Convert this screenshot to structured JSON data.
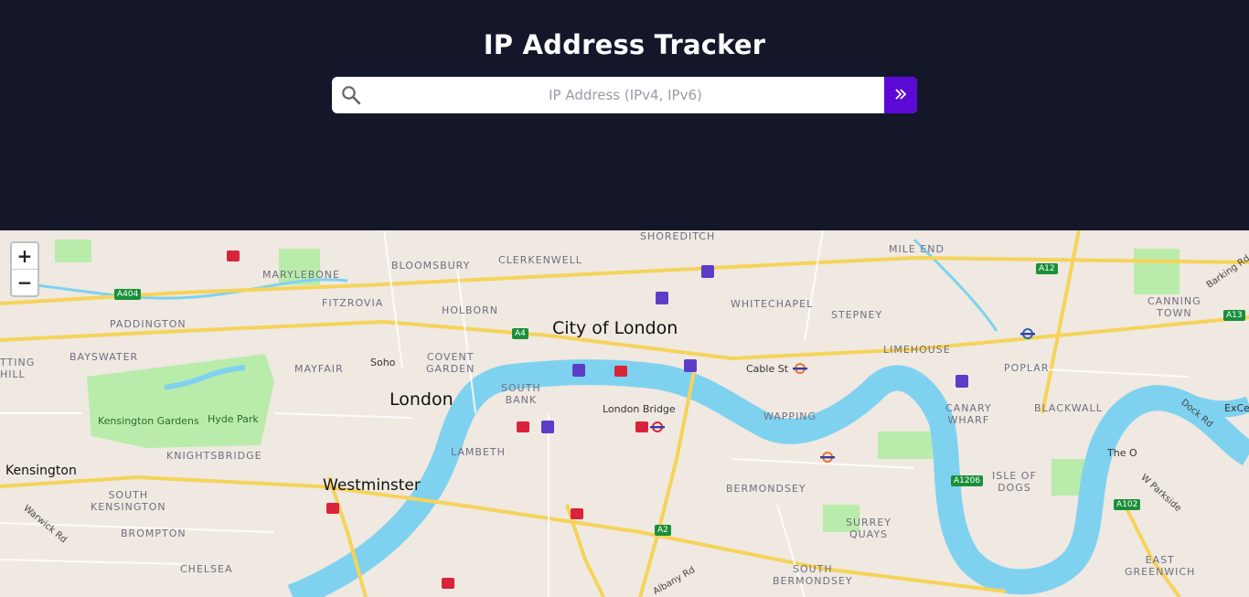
{
  "app": {
    "title": "IP Address Tracker",
    "accent_color": "#5b0ad6",
    "header_background": "#14172a"
  },
  "search": {
    "placeholder": "IP Address (IPv4, IPv6)",
    "value": "",
    "icon": "search-icon",
    "submit_icon": "chevrons-right-icon"
  },
  "map": {
    "zoom_in": "+",
    "zoom_out": "−",
    "labels": {
      "shoreditch": "SHOREDITCH",
      "mile_end": "MILE END",
      "marylebone": "MARYLEBONE",
      "bloomsbury": "BLOOMSBURY",
      "clerkenwell": "CLERKENWELL",
      "fitzrovia": "FITZROVIA",
      "whitechapel": "WHITECHAPEL",
      "canning_town": "CANNING\nTOWN",
      "paddington": "PADDINGTON",
      "holborn": "HOLBORN",
      "city_of_london": "City of London",
      "stepney": "STEPNEY",
      "bayswater": "BAYSWATER",
      "soho": "Soho",
      "covent_garden": "COVENT\nGARDEN",
      "limehouse": "LIMEHOUSE",
      "notting_hill": "TTING\nHILL",
      "mayfair": "MAYFAIR",
      "cable_st": "Cable St",
      "poplar": "POPLAR",
      "south_bank": "SOUTH\nBANK",
      "london": "London",
      "london_bridge": "London Bridge",
      "canary_wharf": "CANARY\nWHARF",
      "blackwall": "BLACKWALL",
      "excel": "ExCe",
      "kensington_gardens": "Kensington Gardens",
      "hyde_park": "Hyde Park",
      "wapping": "WAPPING",
      "dock_rd": "Dock Rd",
      "knightsbridge": "KNIGHTSBRIDGE",
      "lambeth": "LAMBETH",
      "the_o2": "The O",
      "kensington": "Kensington",
      "westminster": "Westminster",
      "isle_of_dogs": "ISLE OF\nDOGS",
      "south_kensington": "SOUTH\nKENSINGTON",
      "bermondsey": "BERMONDSEY",
      "w_parkside": "W Parkside",
      "warwick_rd": "Warwick Rd",
      "brompton": "BROMPTON",
      "surrey_quays": "SURREY\nQUAYS",
      "chelsea": "CHELSEA",
      "south_bermondsey": "SOUTH\nBERMONDSEY",
      "east_greenwich": "EAST\nGREENWICH",
      "albany_rd": "Albany Rd",
      "barking_rd": "Barking Rd"
    },
    "road_shields": {
      "a404": "A404",
      "a12": "A12",
      "a13": "A13",
      "a4": "A4",
      "a1206": "A1206",
      "a102": "A102",
      "a2": "A2"
    }
  }
}
